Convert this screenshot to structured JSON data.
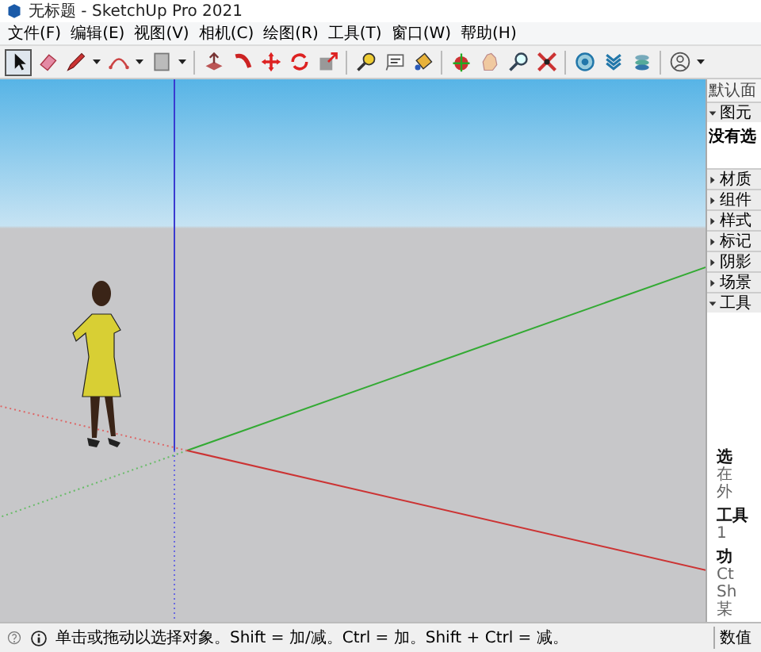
{
  "window": {
    "title": "无标题 - SketchUp Pro 2021"
  },
  "menu": [
    "文件(F)",
    "编辑(E)",
    "视图(V)",
    "相机(C)",
    "绘图(R)",
    "工具(T)",
    "窗口(W)",
    "帮助(H)"
  ],
  "toolbar": {
    "tools": [
      {
        "selected": true
      },
      {
        "selected": false
      },
      {
        "selected": false
      },
      {
        "selected": false
      },
      {
        "selected": false
      },
      {
        "selected": false
      },
      {
        "selected": false
      },
      {
        "selected": false
      },
      {
        "selected": false
      },
      {
        "selected": false
      },
      {
        "selected": false
      },
      {
        "selected": false
      },
      {
        "selected": false
      },
      {
        "selected": false
      },
      {
        "selected": false
      },
      {
        "selected": false
      },
      {
        "selected": false
      },
      {
        "selected": false
      },
      {
        "selected": false
      },
      {
        "selected": false
      },
      {
        "selected": false
      }
    ]
  },
  "tray": {
    "title": "默认面",
    "entity_info": {
      "label": "图元",
      "expanded": true,
      "text": "没有选"
    },
    "panels": [
      {
        "label": "材质",
        "expanded": false
      },
      {
        "label": "组件",
        "expanded": false
      },
      {
        "label": "样式",
        "expanded": false
      },
      {
        "label": "标记",
        "expanded": false
      },
      {
        "label": "阴影",
        "expanded": false
      },
      {
        "label": "场景",
        "expanded": false
      },
      {
        "label": "工具",
        "expanded": true
      }
    ],
    "instructor": [
      {
        "kind": "heading",
        "text": "选"
      },
      {
        "kind": "line",
        "text": "在"
      },
      {
        "kind": "line",
        "text": "外"
      },
      {
        "kind": "heading",
        "text": "工具"
      },
      {
        "kind": "line",
        "text": "1"
      },
      {
        "kind": "heading",
        "text": "功"
      },
      {
        "kind": "line",
        "text": "Ct"
      },
      {
        "kind": "line",
        "text": "Sh"
      },
      {
        "kind": "line",
        "text": "某"
      }
    ]
  },
  "status_bar": {
    "message": "单击或拖动以选择对象。Shift = 加/减。Ctrl = 加。Shift + Ctrl = 减。",
    "measurements_label": "数值"
  }
}
